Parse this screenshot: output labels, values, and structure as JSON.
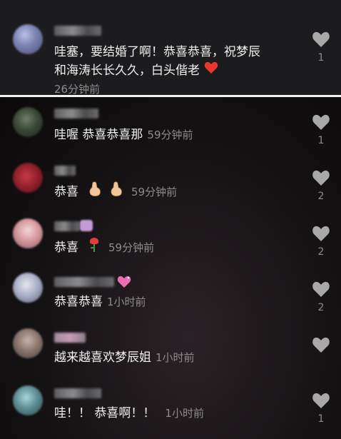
{
  "comments": [
    {
      "text_line1": "哇塞，要结婚了啊！恭喜恭喜，祝梦辰",
      "text_line2": "和海涛长长久久，白头偕老",
      "time": "26分钟前",
      "likes": "1"
    },
    {
      "text": "哇喔 恭喜恭喜那",
      "time": "59分钟前",
      "likes": "1"
    },
    {
      "text": "恭喜",
      "time": "59分钟前",
      "likes": "2"
    },
    {
      "text": "恭喜",
      "time": "59分钟前",
      "likes": "2"
    },
    {
      "text": "恭喜恭喜",
      "time": "1小时前",
      "likes": "2"
    },
    {
      "text": "越来越喜欢梦辰姐",
      "time": "1小时前",
      "likes": ""
    },
    {
      "text": "哇！！ 恭喜啊！！",
      "time": "1小时前",
      "likes": "1"
    }
  ],
  "icons": {
    "like": "heart-icon",
    "red_heart": "red-heart-emoji",
    "pinched_hand": "pinched-fingers-emoji",
    "rose": "rose-emoji",
    "sparkle_heart": "sparkling-heart-emoji"
  },
  "colors": {
    "text": "#f0f0f0",
    "meta": "#8d8d8d",
    "like_icon": "#9a9a9a"
  }
}
